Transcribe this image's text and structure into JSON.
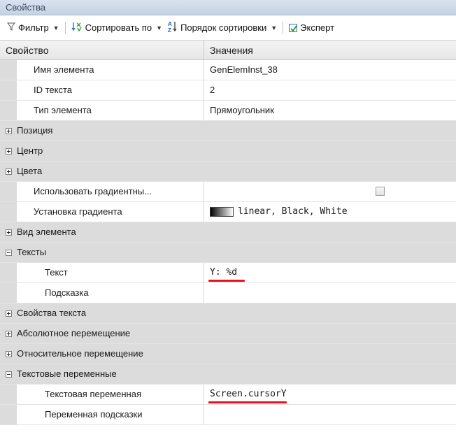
{
  "window": {
    "title": "Свойства"
  },
  "toolbar": {
    "filter_label": "Фильтр",
    "sort_by_label": "Сортировать по",
    "sort_order_label": "Порядок сортировки",
    "expert_label": "Эксперт",
    "expert_checked": true
  },
  "header": {
    "col_property": "Свойство",
    "col_value": "Значения"
  },
  "rows": [
    {
      "name": "Имя элемента",
      "value": "GenElemInst_38"
    },
    {
      "name": "ID текста",
      "value": "2"
    },
    {
      "name": "Тип элемента",
      "value": "Прямоугольник"
    },
    {
      "name": "Позиция"
    },
    {
      "name": "Центр"
    },
    {
      "name": "Цвета"
    },
    {
      "name": "Использовать градиентны...",
      "checked": false
    },
    {
      "name": "Установка градиента",
      "value": "linear, Black, White"
    },
    {
      "name": "Вид элемента"
    },
    {
      "name": "Тексты"
    },
    {
      "name": "Текст",
      "value": "Y: %d"
    },
    {
      "name": "Подсказка",
      "value": ""
    },
    {
      "name": "Свойства текста"
    },
    {
      "name": "Абсолютное перемещение"
    },
    {
      "name": "Относительное перемещение"
    },
    {
      "name": "Текстовые переменные"
    },
    {
      "name": "Текстовая переменная",
      "value": "Screen.cursorY"
    },
    {
      "name": "Переменная подсказки",
      "value": ""
    }
  ],
  "colors": {
    "highlight_underline": "#e8121b",
    "group_background": "#dcdcdc",
    "title_bar": "#c6d2e2"
  }
}
